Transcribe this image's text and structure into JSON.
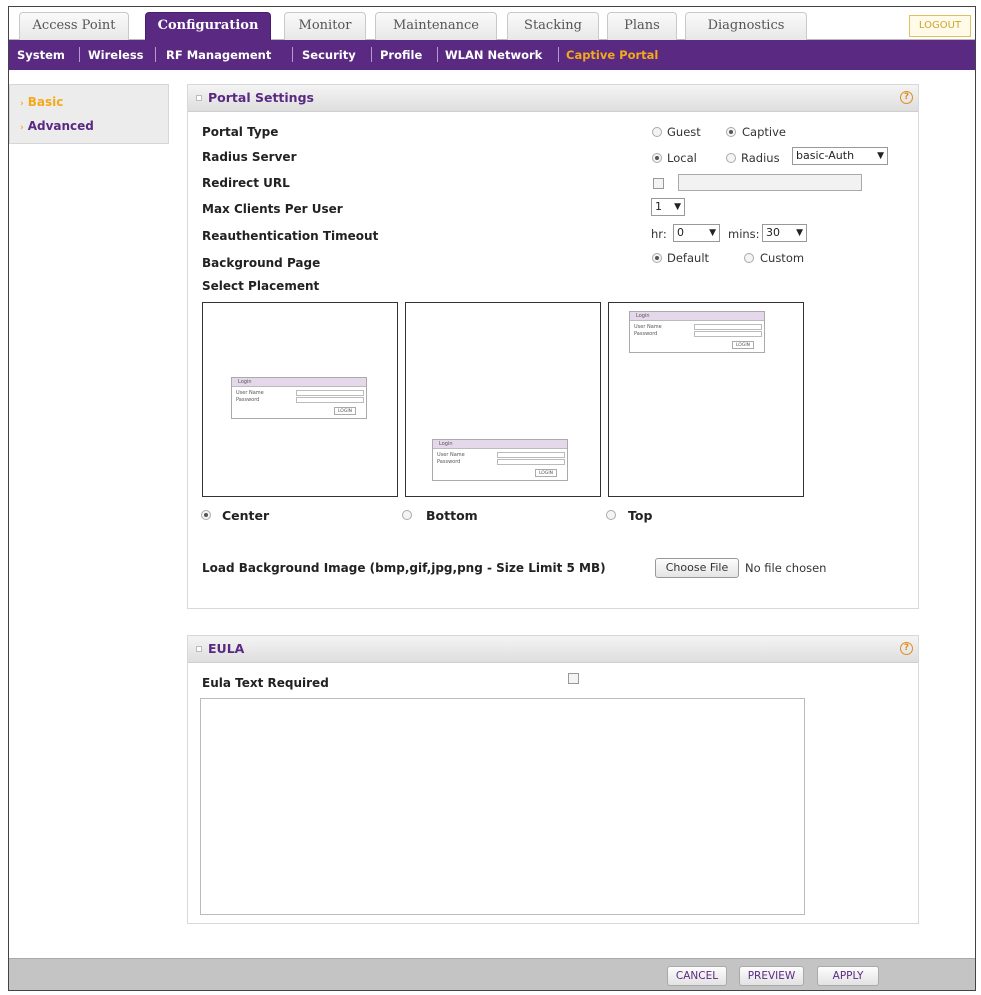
{
  "tabs": [
    {
      "label": "Access Point"
    },
    {
      "label": "Configuration"
    },
    {
      "label": "Monitor"
    },
    {
      "label": "Maintenance"
    },
    {
      "label": "Stacking"
    },
    {
      "label": "Plans"
    },
    {
      "label": "Diagnostics"
    }
  ],
  "logout_label": "LOGOUT",
  "subnav": [
    {
      "label": "System"
    },
    {
      "label": "Wireless"
    },
    {
      "label": "RF Management"
    },
    {
      "label": "Security"
    },
    {
      "label": "Profile"
    },
    {
      "label": "WLAN Network"
    },
    {
      "label": "Captive Portal"
    }
  ],
  "sidebar": [
    {
      "label": "Basic"
    },
    {
      "label": "Advanced"
    }
  ],
  "portal": {
    "title": "Portal Settings",
    "help": "?",
    "labels": {
      "portal_type": "Portal Type",
      "radius_server": "Radius Server",
      "redirect_url": "Redirect URL",
      "max_clients": "Max Clients Per User",
      "reauth_timeout": "Reauthentication Timeout",
      "background_page": "Background Page",
      "select_placement": "Select Placement",
      "load_bg": "Load Background Image (bmp,gif,jpg,png - Size Limit 5 MB)"
    },
    "portal_type_options": [
      "Guest",
      "Captive"
    ],
    "radius_options": [
      "Local",
      "Radius"
    ],
    "radius_select": "basic-Auth",
    "max_clients_value": "1",
    "hr_label": "hr:",
    "hr_value": "0",
    "mins_label": "mins:",
    "mins_value": "30",
    "bg_options": [
      "Default",
      "Custom"
    ],
    "placements": [
      "Center",
      "Bottom",
      "Top"
    ],
    "mini_login": {
      "title": "Login",
      "user": "User Name",
      "pass": "Password",
      "btn": "LOGIN"
    },
    "choose_file": "Choose File",
    "no_file": "No file chosen"
  },
  "eula": {
    "title": "EULA",
    "help": "?",
    "text_required": "Eula Text Required"
  },
  "footer": {
    "cancel": "CANCEL",
    "preview": "PREVIEW",
    "apply": "APPLY"
  }
}
